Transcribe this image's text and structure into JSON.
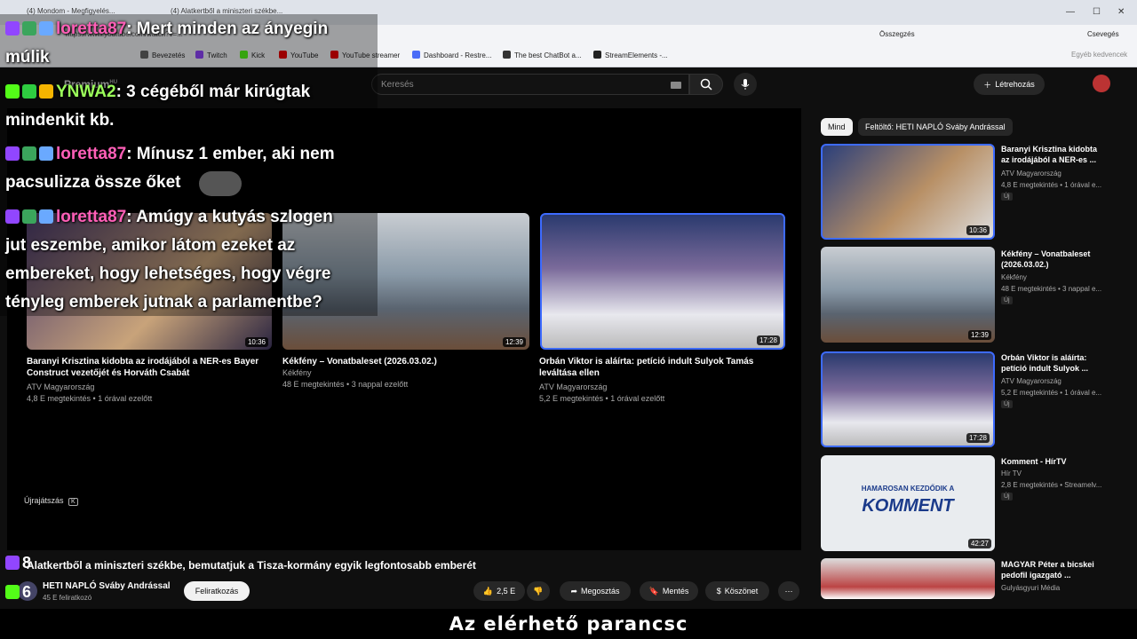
{
  "browser": {
    "tab1": "(4) Mondom - Megfigyelés...",
    "tab2": "(4) Alatkertből a miniszteri székbe...",
    "address": "https://www.youtube.com/watch?v=...",
    "summary": "Összegzés",
    "chat_btn": "Csevegés",
    "favorites": "Egyéb kedvencek",
    "bookmarks": [
      "Bevezetés",
      "Twitch",
      "Kick",
      "YouTube",
      "YouTube streamer",
      "Dashboard - Restre...",
      "The best ChatBot a...",
      "StreamElements -..."
    ]
  },
  "youtube": {
    "logo": "Premium",
    "logo_sup": "HU",
    "search_placeholder": "Keresés",
    "create_label": "Létrehozás",
    "chips": [
      "Mind",
      "Feltöltő: HETI NAPLÓ Sváby Andrással"
    ],
    "replay_label": "Újrajátszás",
    "replay_key": "K",
    "end_cards": [
      {
        "title": "Baranyi Krisztina kidobta az irodájából a NER-es Bayer Construct vezetőjét és Horváth Csabát",
        "channel": "ATV Magyarország",
        "meta": "4,8 E megtekintés • 1 órával ezelőtt",
        "duration": "10:36"
      },
      {
        "title": "Kékfény – Vonatbaleset (2026.03.02.)",
        "channel": "Kékfény",
        "meta": "48 E megtekintés • 3 nappal ezelőtt",
        "duration": "12:39"
      },
      {
        "title": "Orbán Viktor is aláírta: petíció indult Sulyok Tamás leváltása ellen",
        "channel": "ATV Magyarország",
        "meta": "5,2 E megtekintés • 1 órával ezelőtt",
        "duration": "17:28"
      }
    ],
    "video_title": "Alatkertből a miniszteri székbe, bemutatjuk a Tisza-kormány egyik legfontosabb emberét",
    "channel_name": "HETI NAPLÓ Sváby Andrással",
    "subscribers": "45 E feliratkozó",
    "subscribe_label": "Feliratkozás",
    "likes": "2,5 E",
    "share_label": "Megosztás",
    "save_label": "Mentés",
    "thanks_label": "Köszönet",
    "sidebar": [
      {
        "title": "Baranyi Krisztina kidobta az irodájából a NER-es ...",
        "channel": "ATV Magyarország",
        "meta": "4,8 E megtekintés • 1 órával e...",
        "badge": "Új",
        "duration": "10:36"
      },
      {
        "title": "Kékfény – Vonatbaleset (2026.03.02.)",
        "channel": "Kékfény",
        "meta": "48 E megtekintés • 3 nappal e...",
        "badge": "Új",
        "duration": "12:39"
      },
      {
        "title": "Orbán Viktor is aláírta: petíció indult Sulyok ...",
        "channel": "ATV Magyarország",
        "meta": "5,2 E megtekintés • 1 órával e...",
        "badge": "Új",
        "duration": "17:28"
      },
      {
        "title": "Komment - HírTV",
        "channel": "Hír TV",
        "meta": "2,8 E megtekintés • Streamelv...",
        "badge": "Új",
        "duration": "42:27",
        "thumb_text": "KOMMENT",
        "thumb_sub": "HAMAROSAN KEZDŐDIK A"
      },
      {
        "title": "MAGYAR Péter a bicskei pedofil igazgató ...",
        "channel": "Gulyásgyuri Média",
        "meta": "",
        "badge": "",
        "duration": ""
      }
    ]
  },
  "chat": [
    {
      "user": "loretta87",
      "user_color": "#ff5fb7",
      "text": ": Mert minden az ányegin",
      "cont": "múlik"
    },
    {
      "user": "YNWA2",
      "user_color": "#9bff5a",
      "text": ": 3 cégéből már kirúgtak",
      "cont": "mindenkit kb."
    },
    {
      "user": "loretta87",
      "user_color": "#ff5fb7",
      "text": ": Mínusz 1 ember, aki nem",
      "cont": "pacsulizza össze őket"
    },
    {
      "user": "loretta87",
      "user_color": "#ff5fb7",
      "text": ": Amúgy a kutyás szlogen",
      "cont1": "jut eszembe, amikor látom ezeket az",
      "cont2": "embereket, hogy lehetséges, hogy végre",
      "cont3": "tényleg emberek jutnak a parlamentbe?"
    }
  ],
  "counters": {
    "twitch": "8",
    "kick": "6"
  },
  "bottom_caption": "Az elérhető parancsc"
}
